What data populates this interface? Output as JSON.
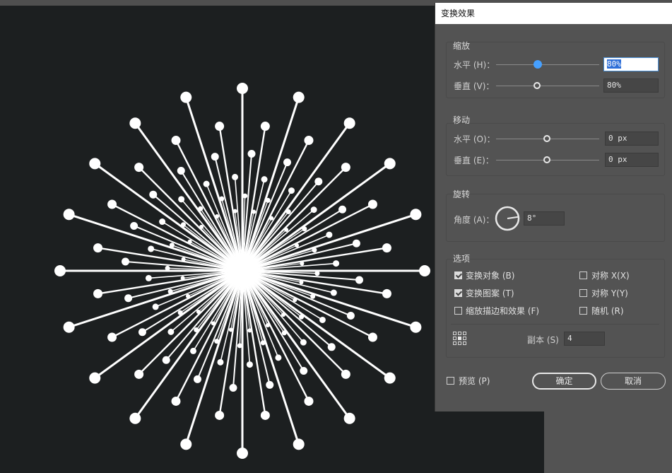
{
  "dialog": {
    "title": "变换效果",
    "scale": {
      "legend": "缩放",
      "h_label": "水平 (H)：",
      "h_value": "80%",
      "h_level_percent": 80,
      "v_label": "垂直 (V)：",
      "v_value": "80%",
      "v_level_percent": 80
    },
    "move": {
      "legend": "移动",
      "h_label": "水平 (O)：",
      "h_value": "0 px",
      "v_label": "垂直 (E)：",
      "v_value": "0 px"
    },
    "rotate": {
      "legend": "旋转",
      "angle_label": "角度 (A)：",
      "angle_value": "8°",
      "angle_degrees": 8
    },
    "options": {
      "legend": "选项",
      "transform_objects": {
        "label": "变换对象 (B)",
        "checked": true
      },
      "transform_patterns": {
        "label": "变换图案 (T)",
        "checked": true
      },
      "scale_strokes": {
        "label": "缩放描边和效果 (F)",
        "checked": false
      },
      "reflect_x": {
        "label": "对称 X(X)",
        "checked": false
      },
      "reflect_y": {
        "label": "对称 Y(Y)",
        "checked": false
      },
      "random": {
        "label": "随机 (R)",
        "checked": false
      },
      "copies_label": "副本 (S)",
      "copies_value": "4"
    },
    "preview": {
      "label": "预览 (P)",
      "checked": false
    },
    "ok_label": "确定",
    "cancel_label": "取消"
  },
  "colors": {
    "canvas": "#1c1f20",
    "dialog": "#535353",
    "artwork": "#ffffff",
    "slider_active": "#46a0ff"
  }
}
